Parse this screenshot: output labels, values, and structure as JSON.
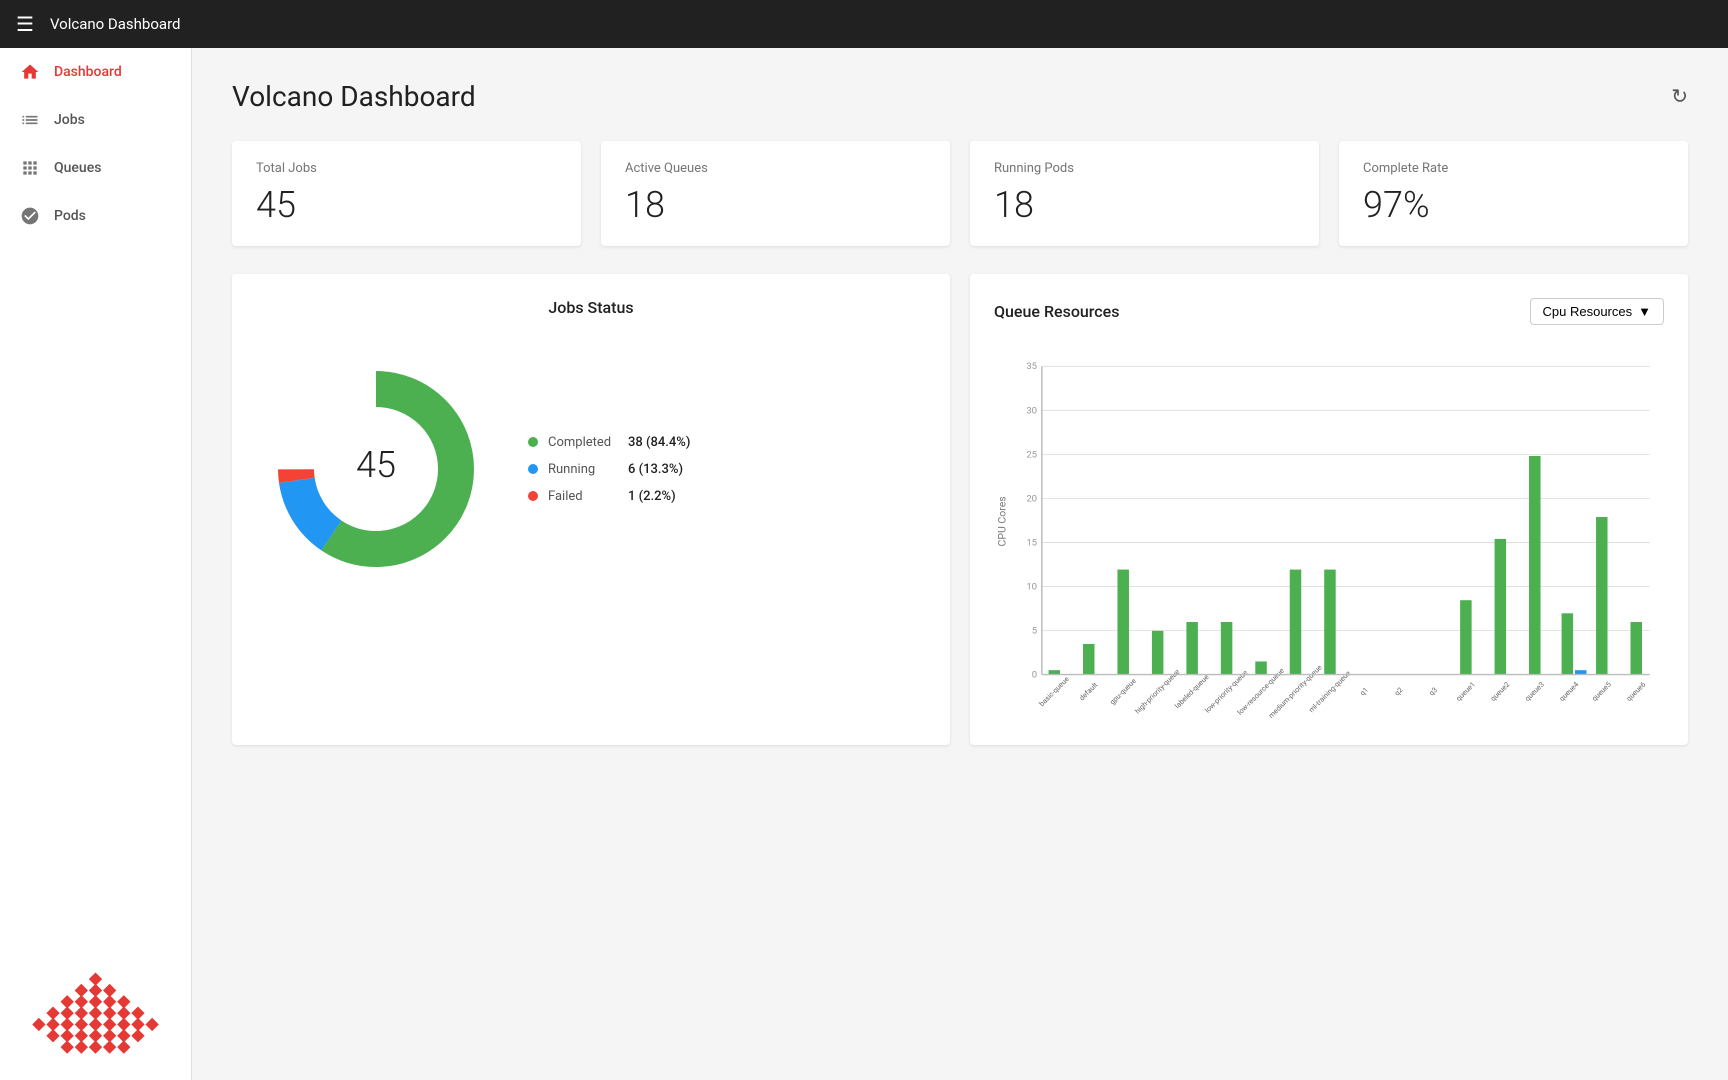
{
  "app": {
    "title": "Volcano Dashboard"
  },
  "topbar": {
    "title": "Volcano Dashboard"
  },
  "sidebar": {
    "items": [
      {
        "id": "dashboard",
        "label": "Dashboard",
        "active": true
      },
      {
        "id": "jobs",
        "label": "Jobs",
        "active": false
      },
      {
        "id": "queues",
        "label": "Queues",
        "active": false
      },
      {
        "id": "pods",
        "label": "Pods",
        "active": false
      }
    ]
  },
  "page": {
    "title": "Volcano Dashboard"
  },
  "stats": {
    "total_jobs_label": "Total Jobs",
    "total_jobs_value": "45",
    "active_queues_label": "Active Queues",
    "active_queues_value": "18",
    "running_pods_label": "Running Pods",
    "running_pods_value": "18",
    "complete_rate_label": "Complete Rate",
    "complete_rate_value": "97%"
  },
  "jobs_status": {
    "title": "Jobs Status",
    "total": "45",
    "legend": [
      {
        "label": "Completed",
        "value": "38 (84.4%)",
        "color": "#4caf50"
      },
      {
        "label": "Running",
        "value": "6 (13.3%)",
        "color": "#2196f3"
      },
      {
        "label": "Failed",
        "value": "1 (2.2%)",
        "color": "#f44336"
      }
    ],
    "donut": {
      "completed_pct": 84.4,
      "running_pct": 13.3,
      "failed_pct": 2.2
    }
  },
  "queue_resources": {
    "title": "Queue Resources",
    "dropdown_label": "Cpu Resources",
    "y_label": "CPU Cores",
    "y_max": 35,
    "y_ticks": [
      0,
      5,
      10,
      15,
      20,
      25,
      30,
      35
    ],
    "bars": [
      {
        "queue": "basic-queue",
        "allocated": 0.5,
        "capacity": 0
      },
      {
        "queue": "default",
        "allocated": 3.5,
        "capacity": 0
      },
      {
        "queue": "gpu-queue",
        "allocated": 12,
        "capacity": 0
      },
      {
        "queue": "high-priority-queue",
        "allocated": 5,
        "capacity": 0
      },
      {
        "queue": "labeled-queue",
        "allocated": 6,
        "capacity": 0
      },
      {
        "queue": "low-priority-queue",
        "allocated": 6,
        "capacity": 0
      },
      {
        "queue": "low-resource-queue",
        "allocated": 1.5,
        "capacity": 0
      },
      {
        "queue": "medium-priority-queue",
        "allocated": 12,
        "capacity": 0
      },
      {
        "queue": "ml-training-queue",
        "allocated": 12,
        "capacity": 0
      },
      {
        "queue": "q1",
        "allocated": 0,
        "capacity": 0
      },
      {
        "queue": "q2",
        "allocated": 0,
        "capacity": 0
      },
      {
        "queue": "q3",
        "allocated": 0,
        "capacity": 0
      },
      {
        "queue": "queue1",
        "allocated": 8.5,
        "capacity": 0
      },
      {
        "queue": "queue2",
        "allocated": 15.5,
        "capacity": 0
      },
      {
        "queue": "queue3",
        "allocated": 25,
        "capacity": 0
      },
      {
        "queue": "queue4",
        "allocated": 7,
        "capacity": 0.5
      },
      {
        "queue": "queue5",
        "allocated": 18,
        "capacity": 0
      },
      {
        "queue": "queue6",
        "allocated": 6,
        "capacity": 0
      }
    ]
  }
}
